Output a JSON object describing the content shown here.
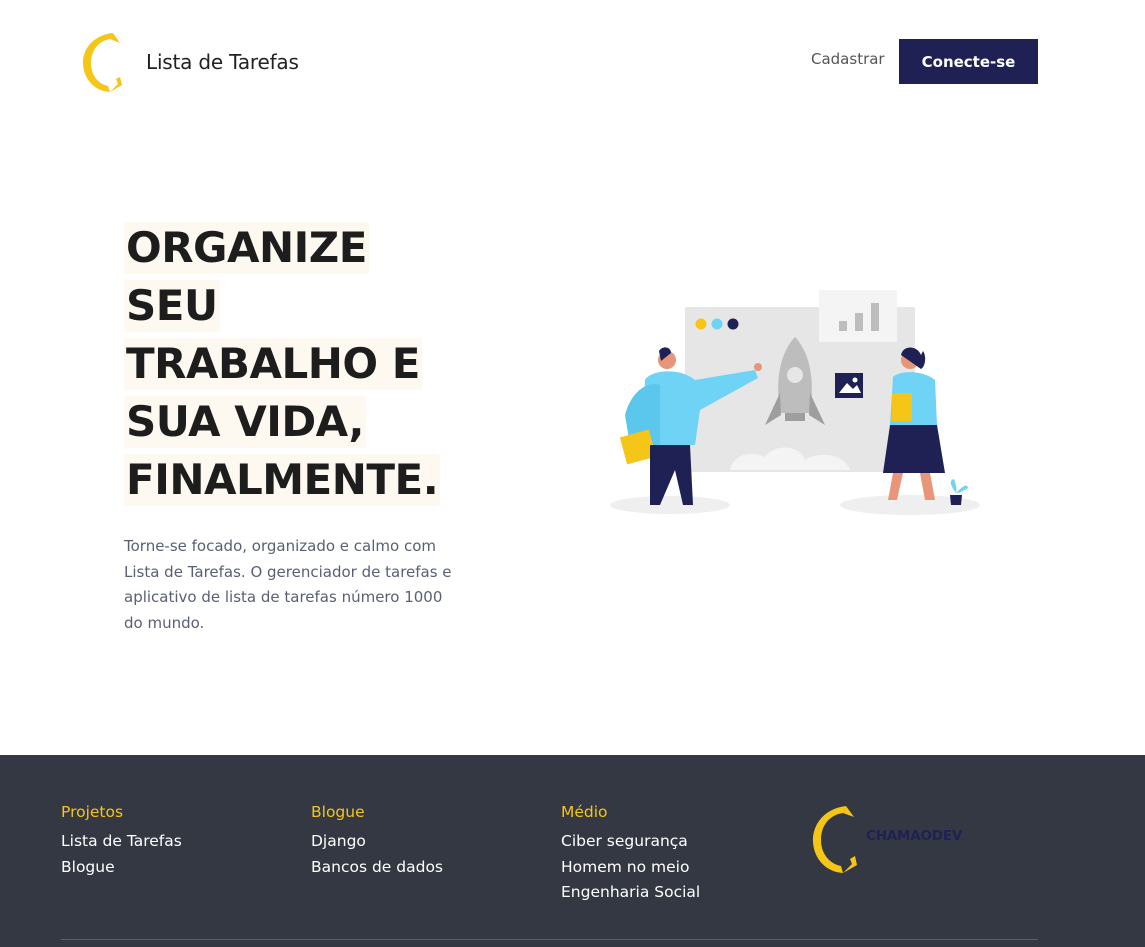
{
  "header": {
    "brand_name": "Lista de Tarefas",
    "register_label": "Cadastrar",
    "login_label": "Conecte-se"
  },
  "hero": {
    "title_lines": [
      "ORGANIZE",
      "SEU",
      "TRABALHO E",
      "SUA VIDA,",
      "FINALMENTE."
    ],
    "description": "Torne-se focado, organizado e calmo com Lista de Tarefas. O gerenciador de tarefas e aplicativo de lista de tarefas número 1000 do mundo."
  },
  "footer": {
    "columns": [
      {
        "title": "Projetos",
        "links": [
          "Lista de Tarefas",
          "Blogue"
        ]
      },
      {
        "title": "Blogue",
        "links": [
          "Django",
          "Bancos de dados"
        ]
      },
      {
        "title": "Médio",
        "links": [
          "Ciber segurança",
          "Homem no meio",
          "Engenharia Social"
        ]
      }
    ],
    "brand_name": "CHAMAODEV"
  },
  "colors": {
    "accent_yellow": "#f5c518",
    "navy": "#1f2155",
    "footer_bg": "#343842",
    "hero_text": "#5a6074"
  },
  "icons": {
    "brand_logo": "c-logo-icon",
    "footer_logo": "c-logo-icon"
  }
}
